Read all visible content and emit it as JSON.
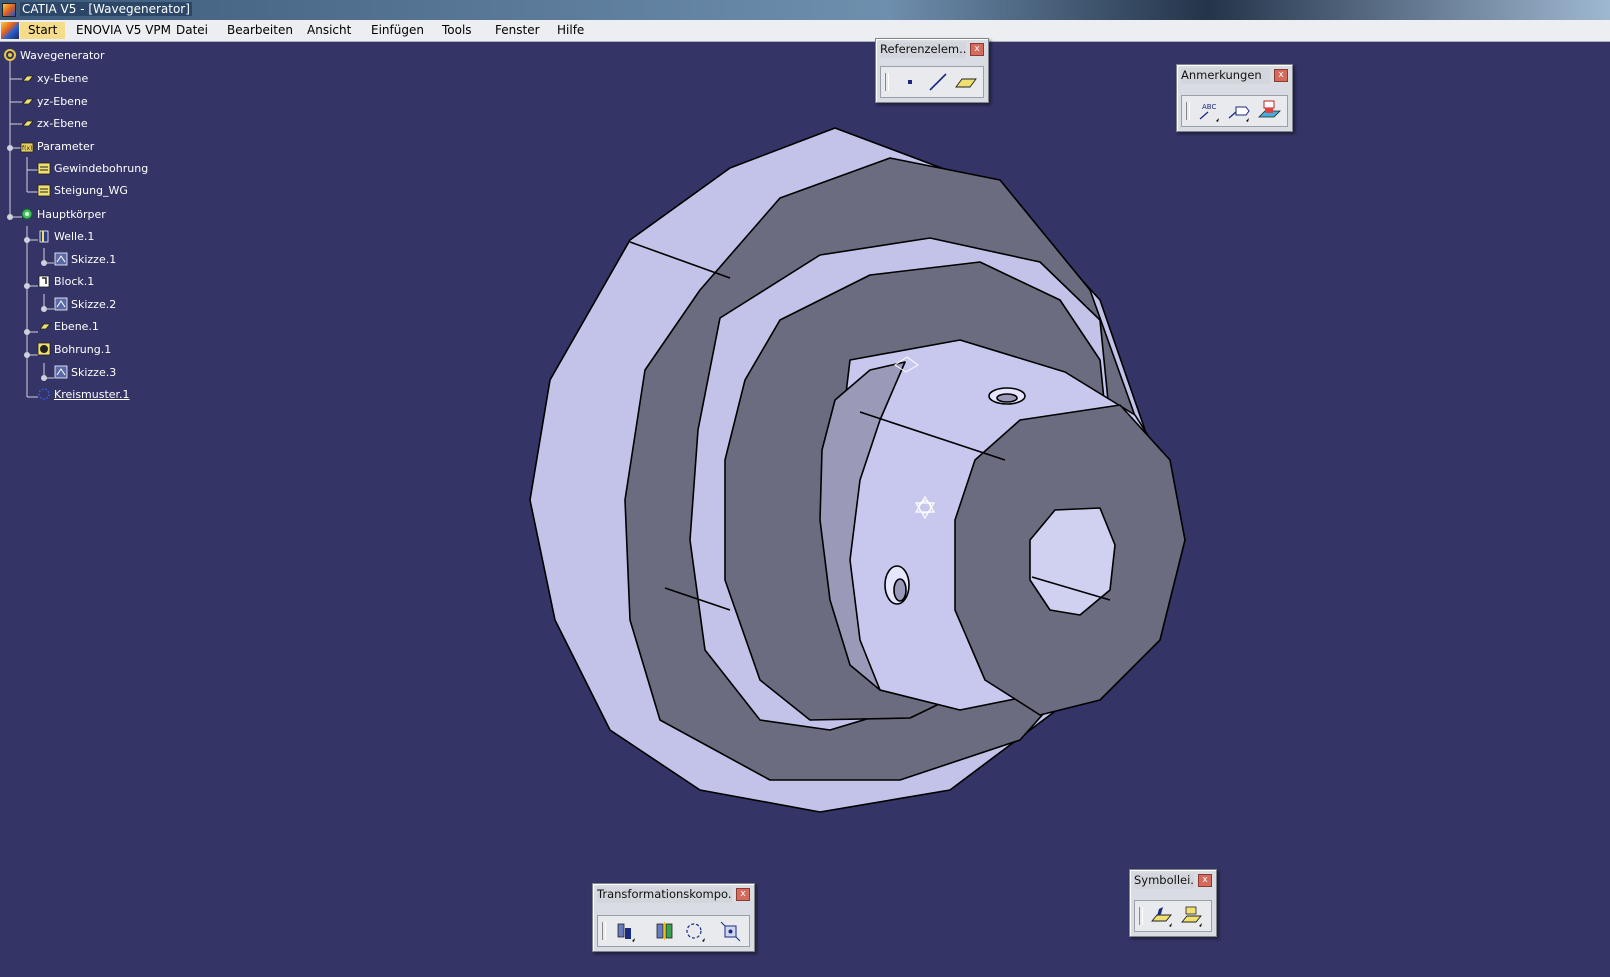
{
  "window": {
    "title": "CATIA V5 - [Wavegenerator]"
  },
  "menu": {
    "start": "Start",
    "enovia": "ENOVIA V5 VPM",
    "datei": "Datei",
    "bearbeiten": "Bearbeiten",
    "ansicht": "Ansicht",
    "einfuegen": "Einfügen",
    "tools": "Tools",
    "fenster": "Fenster",
    "hilfe": "Hilfe"
  },
  "tree": {
    "root": "Wavegenerator",
    "xy": "xy-Ebene",
    "yz": "yz-Ebene",
    "zx": "zx-Ebene",
    "parameter": "Parameter",
    "gewinde": "Gewindebohrung",
    "steigung": "Steigung_WG",
    "hauptkoerper": "Hauptkörper",
    "welle": "Welle.1",
    "skizze1": "Skizze.1",
    "block": "Block.1",
    "skizze2": "Skizze.2",
    "ebene": "Ebene.1",
    "bohrung": "Bohrung.1",
    "skizze3": "Skizze.3",
    "kreismuster": "Kreismuster.1"
  },
  "toolbars": {
    "referenz": {
      "title": "Referenzelem...",
      "icons": [
        "point-icon",
        "line-icon",
        "plane-icon"
      ]
    },
    "anmerkungen": {
      "title": "Anmerkungen",
      "icons": [
        "text-annotation-icon",
        "flag-note-icon",
        "3d-annotation-icon"
      ]
    },
    "transformation": {
      "title": "Transformationskompo...",
      "icons": [
        "translation-icon",
        "symmetry-icon",
        "circular-pattern-icon",
        "scaling-icon"
      ]
    },
    "symbolleiste": {
      "title": "Symbollei...",
      "icons": [
        "open-body-icon",
        "insert-body-icon"
      ]
    }
  },
  "colors": {
    "viewport_bg": "#343466",
    "part_light": "#c9c9f0",
    "part_dark": "#6c6c80",
    "part_outline": "#000000"
  }
}
